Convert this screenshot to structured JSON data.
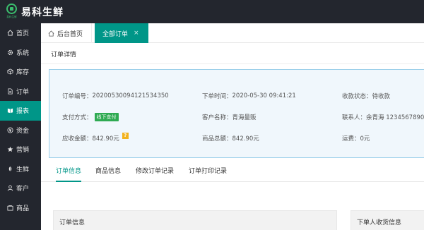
{
  "app": {
    "brand": "易科生鲜",
    "logo_text": "易科生鲜"
  },
  "sidebar": {
    "items": [
      {
        "label": "首页",
        "icon": "home-icon",
        "active": false
      },
      {
        "label": "系统",
        "icon": "gear-icon",
        "active": false
      },
      {
        "label": "库存",
        "icon": "box-icon",
        "active": false
      },
      {
        "label": "订单",
        "icon": "document-icon",
        "active": false
      },
      {
        "label": "报表",
        "icon": "report-icon",
        "active": true
      },
      {
        "label": "资金",
        "icon": "currency-icon",
        "active": false
      },
      {
        "label": "营销",
        "icon": "star-icon",
        "active": false
      },
      {
        "label": "生鲜",
        "icon": "leaf-icon",
        "active": false
      },
      {
        "label": "客户",
        "icon": "user-icon",
        "active": false
      },
      {
        "label": "商品",
        "icon": "product-icon",
        "active": false
      }
    ]
  },
  "tabs": {
    "home_label": "后台首页",
    "active_label": "全部订单",
    "close_glyph": "×"
  },
  "page": {
    "title": "订单详情"
  },
  "order": {
    "row1": {
      "order_no_label": "订单编号：",
      "order_no": "20200530094121534350",
      "order_time_label": "下单时间：",
      "order_time": "2020-05-30 09:41:21",
      "pay_status_label": "收款状态：",
      "pay_status": "待收款"
    },
    "row2": {
      "pay_method_label": "支付方式：",
      "pay_method": "线下支付",
      "customer_label": "客户名称：",
      "customer": "青海量贩",
      "contact_label": "联系人：",
      "contact": "余青海 1234567890"
    },
    "row3": {
      "receivable_label": "应收金额：",
      "receivable": "842.90元",
      "help_glyph": "?",
      "goods_total_label": "商品总额：",
      "goods_total": "842.90元",
      "freight_label": "运费：",
      "freight": "0元"
    }
  },
  "subtabs": [
    "订单信息",
    "商品信息",
    "修改订单记录",
    "订单打印记录"
  ],
  "panels": {
    "left_title": "订单信息",
    "right_title": "下单人收货信息"
  },
  "colors": {
    "accent": "#009688",
    "dark": "#23262e",
    "card_bg": "#f0f7fc",
    "card_border": "#9cd0ea",
    "badge_green": "#2eaa52",
    "badge_orange": "#f2b21d"
  }
}
